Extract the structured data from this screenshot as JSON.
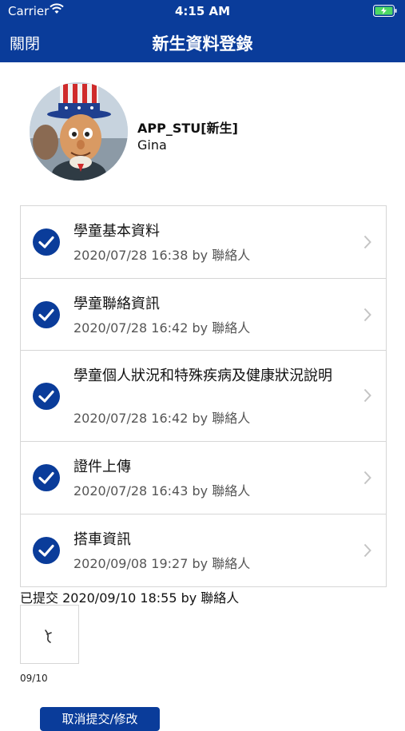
{
  "status_bar": {
    "carrier": "Carrier",
    "time": "4:15 AM"
  },
  "nav": {
    "close_label": "關閉",
    "title": "新生資料登錄"
  },
  "profile": {
    "name": "APP_STU[新生]",
    "subtitle": "Gina"
  },
  "sections": [
    {
      "label": "學童基本資料",
      "meta": "2020/07/28 16:38 by 聯絡人"
    },
    {
      "label": "學童聯絡資訊",
      "meta": "2020/07/28 16:42 by 聯絡人"
    },
    {
      "label": "學童個人狀況和特殊疾病及健康狀況說明",
      "meta": "2020/07/28 16:42 by 聯絡人"
    },
    {
      "label": "證件上傳",
      "meta": "2020/07/28 16:43 by 聯絡人"
    },
    {
      "label": "搭車資訊",
      "meta": "2020/09/08 19:27 by 聯絡人"
    }
  ],
  "submission": {
    "text": "已提交 2020/09/10 18:55 by 聯絡人",
    "thumb_date": "09/10"
  },
  "bottom_button": {
    "label": "取消提交/修改"
  },
  "colors": {
    "primary": "#0a3c9a",
    "check_fill": "#0a3c9a",
    "chevron": "#c4c4c4",
    "border": "#d6d6d6"
  },
  "icons": {
    "wifi": "wifi-icon",
    "battery": "battery-charging-icon",
    "check": "check-circle-icon",
    "chevron": "chevron-right-icon"
  }
}
